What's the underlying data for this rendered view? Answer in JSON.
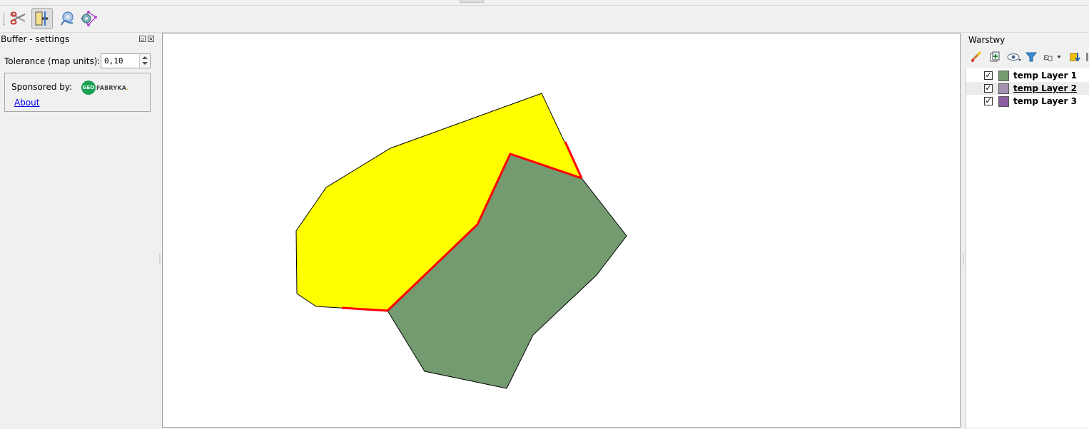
{
  "buffer_panel": {
    "title": "Buffer - settings",
    "tolerance_label": "Tolerance (map units):",
    "tolerance_value": "0,10",
    "sponsored_label": "Sponsored by:",
    "logo_circle_text": "GEO",
    "logo_word": "FABRYKA",
    "logo_dot": ".",
    "about_link": "About"
  },
  "toolbar": {
    "icons": [
      "scissors-icon",
      "split-features-icon",
      "split-parts-icon",
      "vertex-tool-icon"
    ],
    "active": "split-features-icon"
  },
  "layers_panel": {
    "title": "Warstwy",
    "toolbar_icons": [
      "style-brush-icon",
      "add-group-icon",
      "visibility-eye-icon",
      "filter-icon",
      "expression-filter-icon",
      "move-down-icon"
    ],
    "layers": [
      {
        "name": "temp Layer 1",
        "checked": true,
        "selected": false,
        "color": "#739b6f"
      },
      {
        "name": "temp Layer 2",
        "checked": true,
        "selected": true,
        "color": "#a690b0"
      },
      {
        "name": "temp Layer 3",
        "checked": true,
        "selected": false,
        "color": "#8d5ea0"
      }
    ]
  },
  "map": {
    "colors": {
      "yellow_polygon": "#ffff00",
      "green_polygon": "#739b6f",
      "highlight": "#ff0000",
      "outline": "#000000"
    }
  }
}
